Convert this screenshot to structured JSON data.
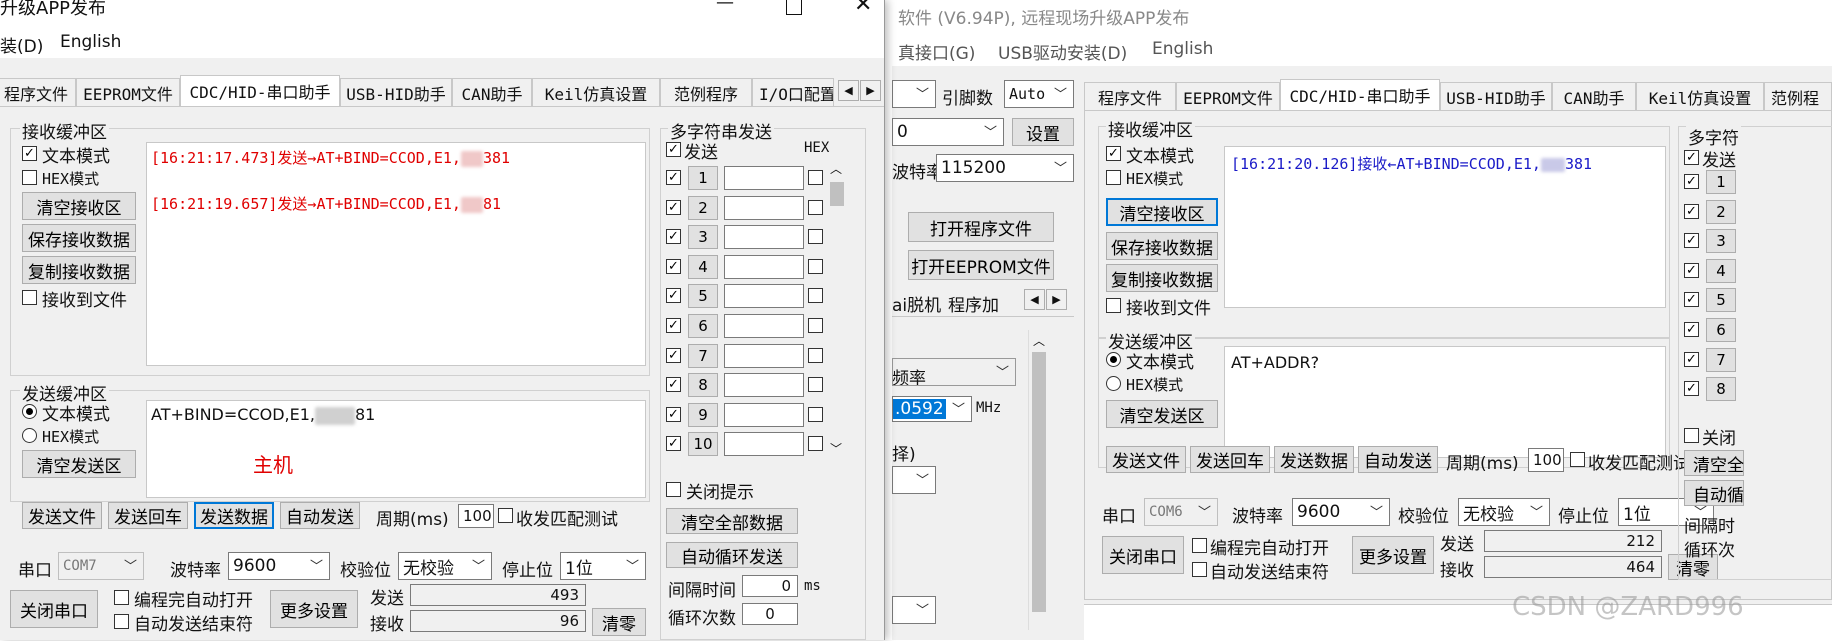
{
  "left_window": {
    "title": "升级APP发布",
    "menu": [
      "装(D)",
      "English"
    ],
    "tabs": [
      "程序文件",
      "EEPROM文件",
      "CDC/HID-串口助手",
      "USB-HID助手",
      "CAN助手",
      "Keil仿真设置",
      "范例程序",
      "I/O口配置"
    ],
    "recv": {
      "title": "接收缓冲区",
      "text_mode": "文本模式",
      "hex_mode": "HEX模式",
      "clear": "清空接收区",
      "save": "保存接收数据",
      "copy": "复制接收数据",
      "to_file": "接收到文件",
      "lines": [
        {
          "prefix": "[16:21:17.473]发送→AT+BIND=CCOD,E1,",
          "suffix": "381"
        },
        {
          "prefix": "[16:21:19.657]发送→AT+BIND=CCOD,E1,",
          "suffix": "81"
        }
      ]
    },
    "send": {
      "title": "发送缓冲区",
      "text_mode": "文本模式",
      "hex_mode": "HEX模式",
      "clear": "清空发送区",
      "content_prefix": "AT+BIND=CCOD,E1,",
      "content_suffix": "81",
      "annotation": "主机"
    },
    "buttons": {
      "send_file": "发送文件",
      "send_enter": "发送回车",
      "send_data": "发送数据",
      "auto_send": "自动发送",
      "period_label": "周期(ms)",
      "period_value": "100",
      "match_test": "收发匹配测试"
    },
    "port": {
      "port_label": "串口",
      "port_value": "COM7",
      "baud_label": "波特率",
      "baud_value": "9600",
      "parity_label": "校验位",
      "parity_value": "无校验",
      "stop_label": "停止位",
      "stop_value": "1位",
      "close_port": "关闭串口",
      "auto_open": "编程完自动打开",
      "auto_send_end": "自动发送结束符",
      "more_settings": "更多设置",
      "sent_label": "发送",
      "sent_value": "493",
      "recv_label": "接收",
      "recv_value": "96",
      "clear_counts": "清零"
    },
    "multi": {
      "title": "多字符串发送",
      "send_header": "发送",
      "hex_header": "HEX",
      "rows": [
        "1",
        "2",
        "3",
        "4",
        "5",
        "6",
        "7",
        "8",
        "9",
        "10"
      ],
      "close_tip": "关闭提示",
      "clear_all": "清空全部数据",
      "auto_loop": "自动循环发送",
      "interval_label": "间隔时间",
      "interval_value": "0",
      "interval_unit": "ms",
      "loop_label": "循环次数",
      "loop_value": "0"
    }
  },
  "right_window": {
    "title": "软件 (V6.94P), 远程现场升级APP发布",
    "menu": [
      "真接口(G)",
      "USB驱动安装(D)",
      "English"
    ],
    "tabs": [
      "程序文件",
      "EEPROM文件",
      "CDC/HID-串口助手",
      "USB-HID助手",
      "CAN助手",
      "Keil仿真设置",
      "范例程"
    ],
    "left_panel": {
      "pins_label": "引脚数",
      "pins_value": "Auto",
      "combo1_value": "0",
      "settings": "设置",
      "baud_label": "波特率",
      "baud_value": "115200",
      "open_program": "打开程序文件",
      "open_eeprom": "打开EEPROM文件",
      "offline_tab": "ai脱机",
      "program_tab": "程序加",
      "freq_label": "频率",
      "freq_value": ".0592",
      "freq_unit": "MHz",
      "select_label": "择)"
    },
    "recv": {
      "title": "接收缓冲区",
      "text_mode": "文本模式",
      "hex_mode": "HEX模式",
      "clear": "清空接收区",
      "save": "保存接收数据",
      "copy": "复制接收数据",
      "to_file": "接收到文件",
      "lines": [
        {
          "prefix": "[16:21:20.126]接收←AT+BIND=CCOD,E1,",
          "suffix": "381"
        }
      ]
    },
    "send": {
      "title": "发送缓冲区",
      "text_mode": "文本模式",
      "hex_mode": "HEX模式",
      "clear": "清空发送区",
      "content": "AT+ADDR?"
    },
    "buttons": {
      "send_file": "发送文件",
      "send_enter": "发送回车",
      "send_data": "发送数据",
      "auto_send": "自动发送",
      "period_label": "周期(ms)",
      "period_value": "100",
      "match_test": "收发匹配测试"
    },
    "port": {
      "port_label": "串口",
      "port_value": "COM6",
      "baud_label": "波特率",
      "baud_value": "9600",
      "parity_label": "校验位",
      "parity_value": "无校验",
      "stop_label": "停止位",
      "stop_value": "1位",
      "close_port": "关闭串口",
      "auto_open": "编程完自动打开",
      "auto_send_end": "自动发送结束符",
      "more_settings": "更多设置",
      "sent_label": "发送",
      "sent_value": "212",
      "recv_label": "接收",
      "recv_value": "464",
      "clear_counts": "清零"
    },
    "multi": {
      "title": "多字符",
      "send_header": "发送",
      "rows": [
        "1",
        "2",
        "3",
        "4",
        "5",
        "6",
        "7",
        "8"
      ],
      "close_tip": "关闭",
      "clear_all": "清空全",
      "auto_loop": "自动循",
      "interval_label": "间隔时",
      "loop_label": "循环次"
    }
  },
  "watermark": "CSDN @ZARD996",
  "colors": {
    "window_bg": "#f0f0f0",
    "sent_text": "#e00000",
    "recv_text": "#1a1ac8",
    "focus_border": "#0078d7"
  }
}
